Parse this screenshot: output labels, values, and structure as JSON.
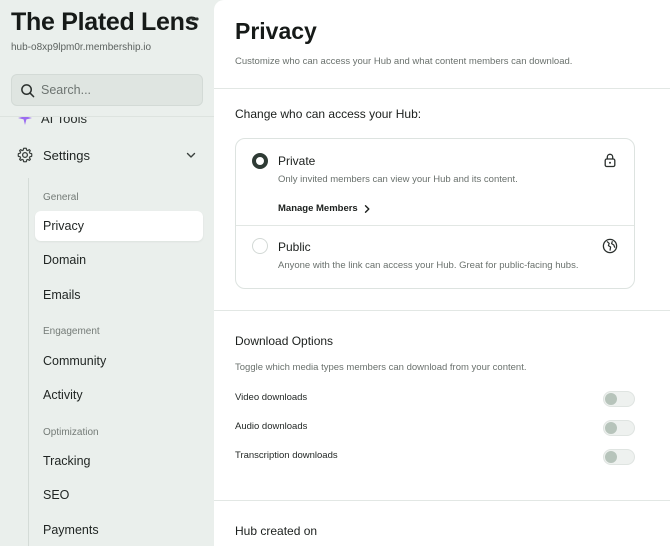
{
  "sidebar": {
    "hub_title": "The Plated Lens",
    "hub_url": "hub-o8xp9lpm0r.membership.io",
    "search_placeholder": "Search...",
    "ai_tools_label": "AI Tools",
    "settings_label": "Settings",
    "groups": {
      "general": "General",
      "engagement": "Engagement",
      "optimization": "Optimization"
    },
    "items": {
      "privacy": "Privacy",
      "domain": "Domain",
      "emails": "Emails",
      "community": "Community",
      "activity": "Activity",
      "tracking": "Tracking",
      "seo": "SEO",
      "payments": "Payments"
    },
    "active_item": "Privacy",
    "accent_color": "#9b6cf0"
  },
  "main": {
    "title": "Privacy",
    "subtitle": "Customize who can access your Hub and what content members can download.",
    "access": {
      "heading": "Change who can access your Hub:",
      "private": {
        "label": "Private",
        "description": "Only invited members can view your Hub and its content.",
        "link": "Manage Members",
        "icon": "lock-icon",
        "selected": true
      },
      "public": {
        "label": "Public",
        "description": "Anyone with the link can access your Hub. Great for public-facing hubs.",
        "icon": "globe-icon",
        "selected": false
      }
    },
    "downloads": {
      "heading": "Download Options",
      "description": "Toggle which media types members can download from your content.",
      "toggles": [
        {
          "label": "Video downloads",
          "enabled": false
        },
        {
          "label": "Audio downloads",
          "enabled": false
        },
        {
          "label": "Transcription downloads",
          "enabled": false
        }
      ]
    },
    "created_heading": "Hub created on"
  }
}
